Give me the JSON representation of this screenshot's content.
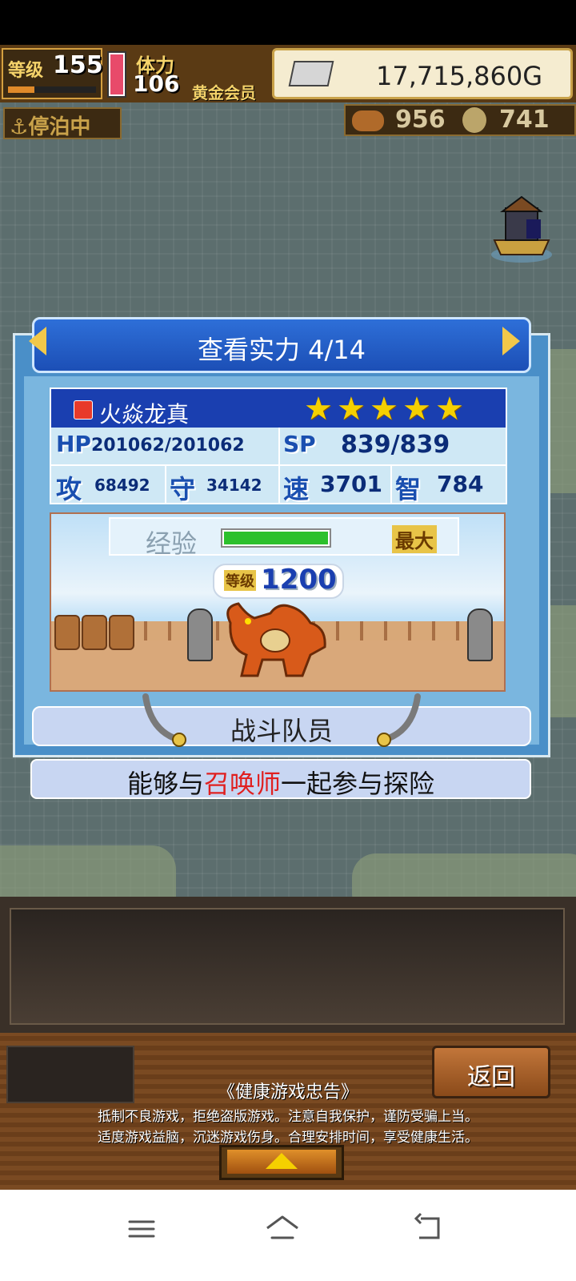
{
  "header": {
    "level_label": "等级",
    "level": "155",
    "level_progress": 0.3,
    "stamina_label": "体力",
    "stamina": "106",
    "stamina_fill": 1.0,
    "membership": "黄金会员",
    "gold": "17,715,860G",
    "status": "停泊中",
    "resource_1": "956",
    "resource_2": "741"
  },
  "dialog": {
    "title": "查看实力 4/14",
    "character": {
      "name": "火焱龙真",
      "stars": [
        "★",
        "★",
        "★",
        "★",
        "★"
      ],
      "hp_label": "HP",
      "hp": "201062/201062",
      "sp_label": "SP",
      "sp": "839/839",
      "atk_label": "攻",
      "atk": "68492",
      "def_label": "守",
      "def": "34142",
      "spd_label": "速",
      "spd": "3701",
      "int_label": "智",
      "int": "784"
    },
    "exp_label": "经验",
    "exp_progress": 1.0,
    "exp_max_label": "最大",
    "level_label": "等级",
    "level": "1200",
    "role": "战斗队员",
    "description_parts": [
      "能够与",
      "召唤师",
      "一起参与探险"
    ]
  },
  "footer": {
    "back_label": "返回",
    "advisory_title": "《健康游戏忠告》",
    "advisory_line1": "抵制不良游戏，拒绝盗版游戏。注意自我保护，谨防受骗上当。",
    "advisory_line2": "适度游戏益脑，沉迷游戏伤身。合理安排时间，享受健康生活。"
  },
  "colors": {
    "title_blue": "#1c4fb6",
    "exp_green": "#2cc02c",
    "highlight_red": "#e02020",
    "star_yellow": "#f5d000"
  },
  "icons": [
    "anchor-icon",
    "silver-ingot-icon",
    "meat-icon",
    "coin-icon",
    "fire-element-icon",
    "sword-icon",
    "menu-icon",
    "home-icon",
    "back-icon"
  ]
}
